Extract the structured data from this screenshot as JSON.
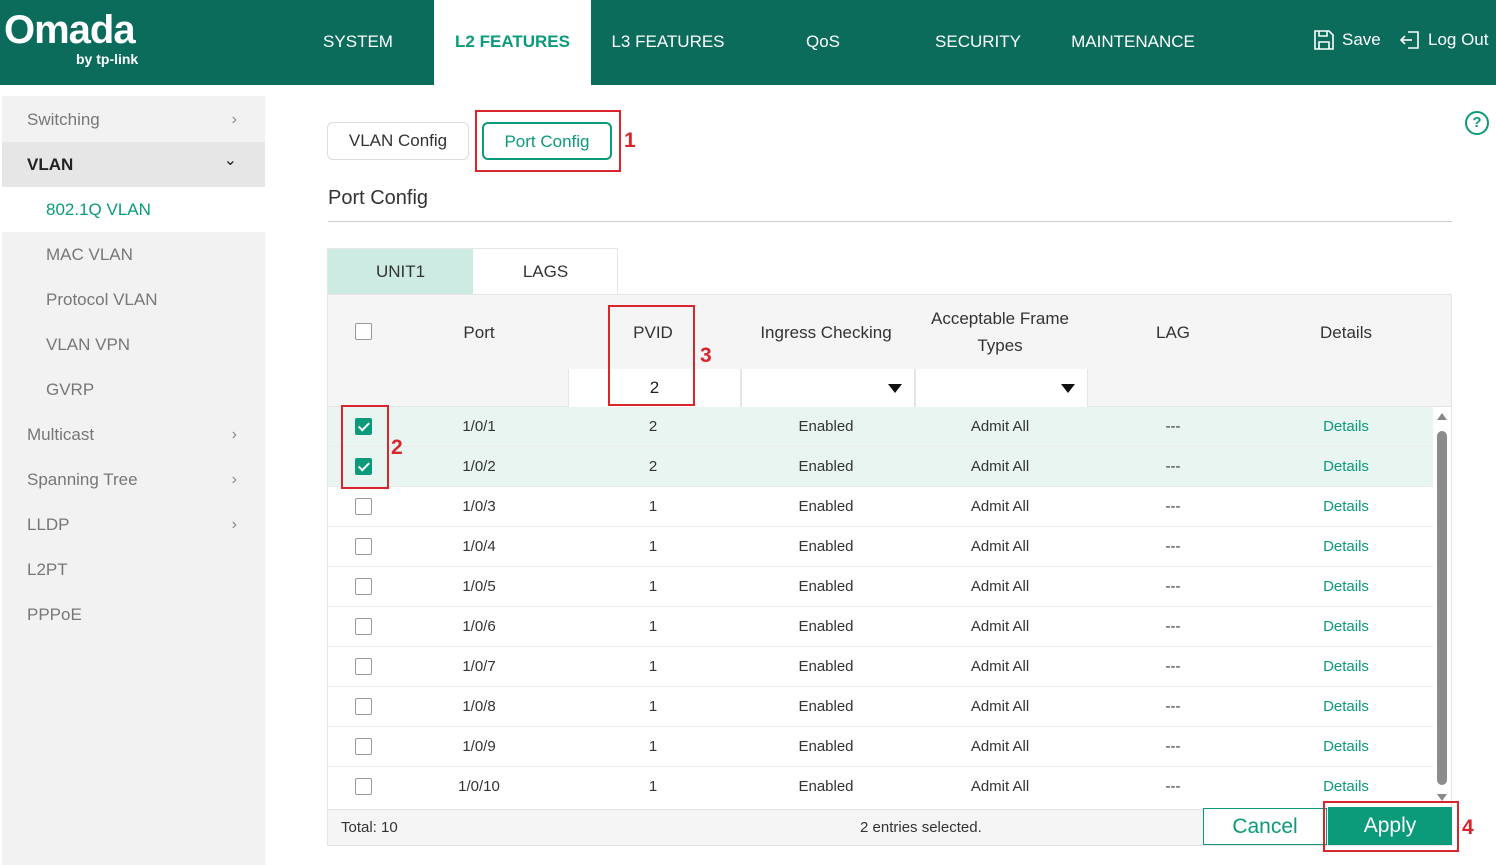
{
  "header": {
    "logo_main": "Omada",
    "logo_sub": "by tp-link",
    "nav": [
      "SYSTEM",
      "L2 FEATURES",
      "L3 FEATURES",
      "QoS",
      "SECURITY",
      "MAINTENANCE"
    ],
    "active_nav": "L2 FEATURES",
    "save_label": "Save",
    "logout_label": "Log Out"
  },
  "sidebar": {
    "items": [
      {
        "label": "Switching",
        "chevron": "›"
      },
      {
        "label": "VLAN",
        "chevron": "⌄"
      },
      {
        "label": "802.1Q VLAN"
      },
      {
        "label": "MAC VLAN"
      },
      {
        "label": "Protocol VLAN"
      },
      {
        "label": "VLAN VPN"
      },
      {
        "label": "GVRP"
      },
      {
        "label": "Multicast",
        "chevron": "›"
      },
      {
        "label": "Spanning Tree",
        "chevron": "›"
      },
      {
        "label": "LLDP",
        "chevron": "›"
      },
      {
        "label": "L2PT"
      },
      {
        "label": "PPPoE"
      }
    ]
  },
  "main": {
    "tabs": [
      "VLAN Config",
      "Port Config"
    ],
    "section_title": "Port Config",
    "unit_tabs": [
      "UNIT1",
      "LAGS"
    ],
    "help_label": "?"
  },
  "annotations": [
    "1",
    "2",
    "3",
    "4"
  ],
  "table": {
    "headers": {
      "port": "Port",
      "pvid": "PVID",
      "ingress": "Ingress Checking",
      "frame_types_1": "Acceptable Frame",
      "frame_types_2": "Types",
      "lag": "LAG",
      "details": "Details"
    },
    "filter": {
      "pvid_value": "2"
    },
    "rows": [
      {
        "checked": true,
        "port": "1/0/1",
        "pvid": "2",
        "ingress": "Enabled",
        "frame": "Admit All",
        "lag": "---",
        "details": "Details"
      },
      {
        "checked": true,
        "port": "1/0/2",
        "pvid": "2",
        "ingress": "Enabled",
        "frame": "Admit All",
        "lag": "---",
        "details": "Details"
      },
      {
        "checked": false,
        "port": "1/0/3",
        "pvid": "1",
        "ingress": "Enabled",
        "frame": "Admit All",
        "lag": "---",
        "details": "Details"
      },
      {
        "checked": false,
        "port": "1/0/4",
        "pvid": "1",
        "ingress": "Enabled",
        "frame": "Admit All",
        "lag": "---",
        "details": "Details"
      },
      {
        "checked": false,
        "port": "1/0/5",
        "pvid": "1",
        "ingress": "Enabled",
        "frame": "Admit All",
        "lag": "---",
        "details": "Details"
      },
      {
        "checked": false,
        "port": "1/0/6",
        "pvid": "1",
        "ingress": "Enabled",
        "frame": "Admit All",
        "lag": "---",
        "details": "Details"
      },
      {
        "checked": false,
        "port": "1/0/7",
        "pvid": "1",
        "ingress": "Enabled",
        "frame": "Admit All",
        "lag": "---",
        "details": "Details"
      },
      {
        "checked": false,
        "port": "1/0/8",
        "pvid": "1",
        "ingress": "Enabled",
        "frame": "Admit All",
        "lag": "---",
        "details": "Details"
      },
      {
        "checked": false,
        "port": "1/0/9",
        "pvid": "1",
        "ingress": "Enabled",
        "frame": "Admit All",
        "lag": "---",
        "details": "Details"
      },
      {
        "checked": false,
        "port": "1/0/10",
        "pvid": "1",
        "ingress": "Enabled",
        "frame": "Admit All",
        "lag": "---",
        "details": "Details"
      }
    ],
    "footer": {
      "total": "Total: 10",
      "selected": "2 entries selected."
    }
  },
  "actions": {
    "cancel_label": "Cancel",
    "apply_label": "Apply"
  },
  "colors": {
    "brand": "#0b6c5b",
    "accent": "#0b9a7a",
    "annotation": "#d9262c"
  }
}
